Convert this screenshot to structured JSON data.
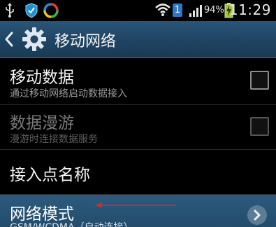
{
  "status_bar": {
    "time": "11:29",
    "battery_percent": "94%",
    "notification_badge": "1",
    "icons": [
      "usb-icon",
      "shield-icon",
      "sync-icon",
      "wifi-icon",
      "signal-icon",
      "battery-charging-icon"
    ]
  },
  "action_bar": {
    "title": "移动网络"
  },
  "settings": [
    {
      "title": "移动数据",
      "subtitle": "通过移动网络启动数据接入",
      "control": "checkbox",
      "checked": false,
      "enabled": true
    },
    {
      "title": "数据漫游",
      "subtitle": "漫游时连接数据服务",
      "control": "checkbox",
      "checked": false,
      "enabled": false
    },
    {
      "title": "接入点名称",
      "enabled": true
    },
    {
      "title": "网络模式",
      "subtitle": "GSM/WCDMA（自动连接）",
      "control": "chevron",
      "highlighted": true
    }
  ],
  "colors": {
    "action_bar": "#1f4462",
    "highlight": "#2c5a7e",
    "annotation_arrow": "#d42a2a"
  }
}
